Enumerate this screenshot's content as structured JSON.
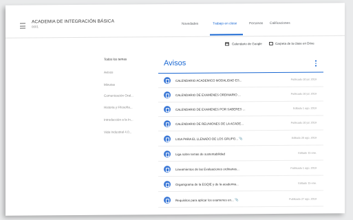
{
  "header": {
    "course_title": "ACADEMIA DE INTEGRACIÓN BÁSICA",
    "course_subtitle": "0001"
  },
  "tabs": [
    {
      "label": "Novedades",
      "active": false
    },
    {
      "label": "Trabajo en clase",
      "active": true
    },
    {
      "label": "Personas",
      "active": false
    },
    {
      "label": "Calificaciones",
      "active": false
    }
  ],
  "resources": {
    "calendar_label": "Calendario de Google",
    "folder_label": "Carpeta de la clase en Drive"
  },
  "sidebar": {
    "items": [
      {
        "label": "Todos los temas",
        "active": true
      },
      {
        "label": "Avisos",
        "active": false
      },
      {
        "label": "Minutas",
        "active": false
      },
      {
        "label": "Comunicación Oral...",
        "active": false
      },
      {
        "label": "Historia y Filosofía...",
        "active": false
      },
      {
        "label": "Introducción a la In...",
        "active": false
      },
      {
        "label": "Vida Industrial 4.0...",
        "active": false
      }
    ]
  },
  "section": {
    "title": "Avisos"
  },
  "posts": [
    {
      "title": "CALENDARIO ACADEMICO MODALIDAD ES...",
      "date": "Publicado 30 jul. 2019",
      "icon": "assignment-icon"
    },
    {
      "title": "CALENDARIO DE EXAMENES ORDINARIO ...",
      "date": "Publicado 30 jul. 2019",
      "icon": "assignment-icon"
    },
    {
      "title": "CALENDARIO DE EXAMENES POR SABERES ...",
      "date": "Editado 1 ago. 2019",
      "icon": "assignment-icon"
    },
    {
      "title": "CALENDARIO DE REUNIONES DE LA ACADE...",
      "date": "Publicado 30 jul. 2019",
      "icon": "assignment-icon"
    },
    {
      "title": "LIGA PARA EL LLENADO DE LOS GRUPO... 📎",
      "date": "Editado 20 ago. 2019",
      "icon": "assignment-icon"
    },
    {
      "title": "Liga sobre temas de sustentabilidad",
      "date": "Editado 15 ene.",
      "icon": "assignment-icon"
    },
    {
      "title": "Lineamientos de las Evaluaciones ordinarias...",
      "date": "Publicado 1 ago. 2019",
      "icon": "assignment-icon"
    },
    {
      "title": "Organigrama de la EGQIE y de la academia...",
      "date": "Editado 15 ene.",
      "icon": "quiz-icon"
    },
    {
      "title": "Requisitos para aplicar los examenes en... 📎",
      "date": "Publicado 27 ago. 2019",
      "icon": "quiz-icon"
    }
  ],
  "colors": {
    "accent": "#1967d2",
    "icon_bg": "#3b78d6"
  }
}
